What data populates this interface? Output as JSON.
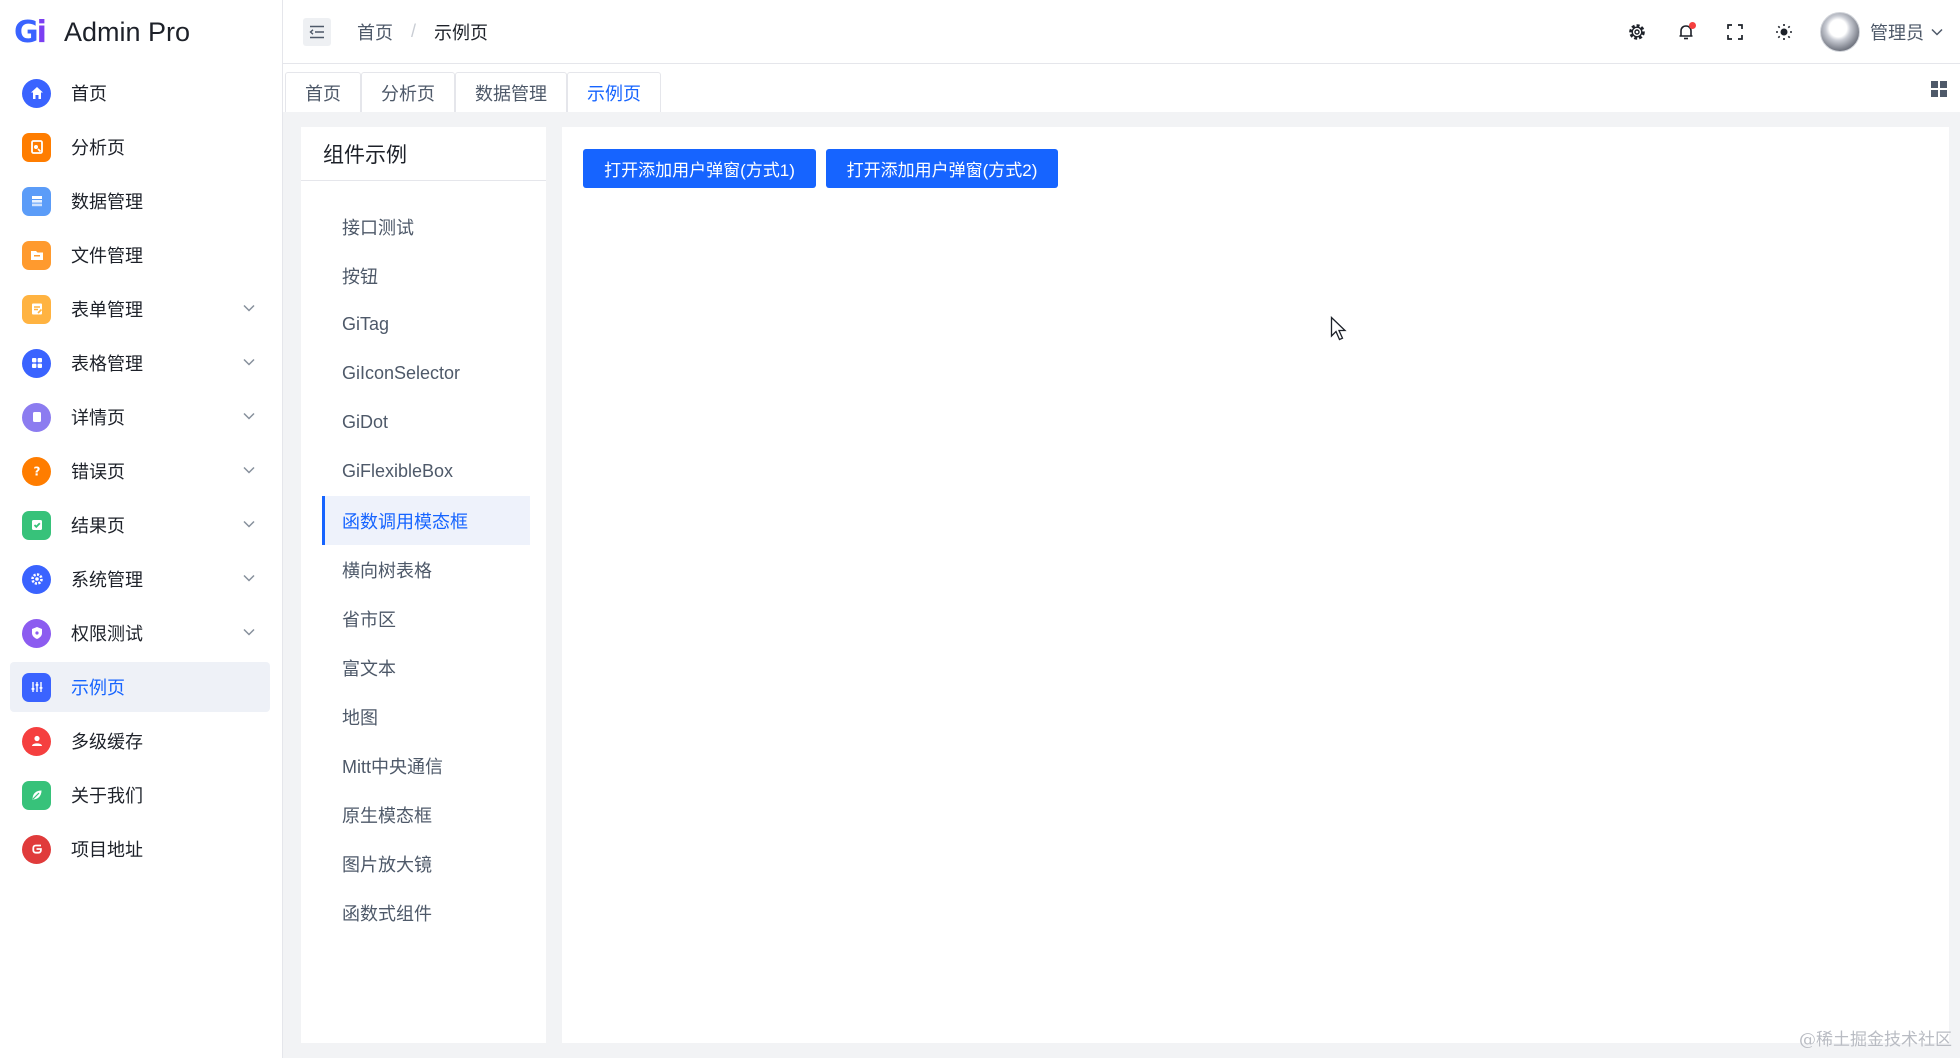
{
  "app": {
    "title": "Admin Pro",
    "logo_letters": "Gi"
  },
  "sidebar": {
    "items": [
      {
        "label": "首页",
        "icon": "home-icon",
        "color": "#3a63ff",
        "expandable": false
      },
      {
        "label": "分析页",
        "icon": "analysis-icon",
        "color": "#ff7d00",
        "expandable": false
      },
      {
        "label": "数据管理",
        "icon": "database-icon",
        "color": "#5b9cf8",
        "expandable": false
      },
      {
        "label": "文件管理",
        "icon": "folder-icon",
        "color": "#ff9a2e",
        "expandable": false
      },
      {
        "label": "表单管理",
        "icon": "form-icon",
        "color": "#ffb341",
        "expandable": true
      },
      {
        "label": "表格管理",
        "icon": "table-icon",
        "color": "#3a63ff",
        "expandable": true
      },
      {
        "label": "详情页",
        "icon": "detail-icon",
        "color": "#8c7cf0",
        "expandable": true
      },
      {
        "label": "错误页",
        "icon": "error-icon",
        "color": "#ff7d00",
        "expandable": true
      },
      {
        "label": "结果页",
        "icon": "result-icon",
        "color": "#37c27a",
        "expandable": true
      },
      {
        "label": "系统管理",
        "icon": "settings-icon",
        "color": "#3a63ff",
        "expandable": true
      },
      {
        "label": "权限测试",
        "icon": "shield-icon",
        "color": "#8c5cf0",
        "expandable": true
      },
      {
        "label": "示例页",
        "icon": "sliders-icon",
        "color": "#3a63ff",
        "expandable": false,
        "active": true
      },
      {
        "label": "多级缓存",
        "icon": "user-icon",
        "color": "#f53f3f",
        "expandable": false
      },
      {
        "label": "关于我们",
        "icon": "leaf-icon",
        "color": "#37c27a",
        "expandable": false
      },
      {
        "label": "项目地址",
        "icon": "gitee-icon",
        "color": "#e03b3b",
        "expandable": false
      }
    ]
  },
  "header": {
    "breadcrumb": [
      "首页",
      "示例页"
    ],
    "breadcrumb_sep": "/",
    "user_name": "管理员"
  },
  "tabs": [
    {
      "label": "首页",
      "active": false
    },
    {
      "label": "分析页",
      "active": false
    },
    {
      "label": "数据管理",
      "active": false
    },
    {
      "label": "示例页",
      "active": true
    }
  ],
  "sub_panel": {
    "title": "组件示例",
    "items": [
      {
        "label": "接口测试"
      },
      {
        "label": "按钮"
      },
      {
        "label": "GiTag"
      },
      {
        "label": "GiIconSelector"
      },
      {
        "label": "GiDot"
      },
      {
        "label": "GiFlexibleBox"
      },
      {
        "label": "函数调用模态框",
        "active": true
      },
      {
        "label": "横向树表格"
      },
      {
        "label": "省市区"
      },
      {
        "label": "富文本"
      },
      {
        "label": "地图"
      },
      {
        "label": "Mitt中央通信"
      },
      {
        "label": "原生模态框"
      },
      {
        "label": "图片放大镜"
      },
      {
        "label": "函数式组件"
      }
    ]
  },
  "main": {
    "button1": "打开添加用户弹窗(方式1)",
    "button2": "打开添加用户弹窗(方式2)"
  },
  "watermark": "@稀土掘金技术社区",
  "colors": {
    "primary": "#1664ff",
    "text": "#1d2129",
    "muted": "#4e5969"
  }
}
